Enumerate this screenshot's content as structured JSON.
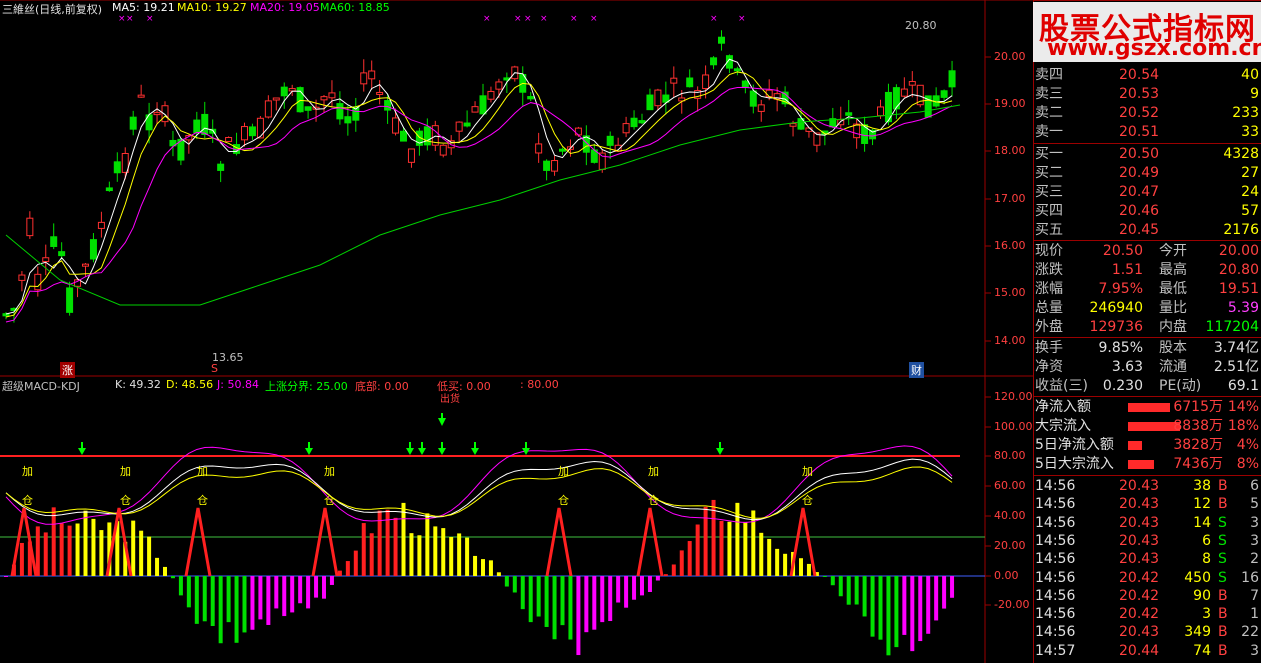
{
  "title": "三維丝(日线,前复权)",
  "ma": [
    {
      "label": "MA5: 19.21",
      "color": "#ffffff"
    },
    {
      "label": "MA10: 19.27",
      "color": "#ffff00"
    },
    {
      "label": "MA20: 19.05",
      "color": "#ff00ff"
    },
    {
      "label": "MA60: 18.85",
      "color": "#00ff00"
    }
  ],
  "price_axis": [
    "20.00",
    "19.00",
    "18.00",
    "17.00",
    "16.00",
    "15.00",
    "14.00"
  ],
  "annotations": {
    "high": "20.80",
    "low": "13.65",
    "zhang": "涨",
    "s": "S",
    "cai": "财"
  },
  "indicator": {
    "name": "超级MACD-KDJ",
    "k": "K: 49.32",
    "d": "D: 48.56",
    "j": "J: 50.84",
    "upper": "上涨分界: 25.00",
    "bottom": "底部: 0.00",
    "dimai": "低买: 0.00",
    "dimai2": ": 80.00",
    "chuhuo": "出货"
  },
  "ind_axis": [
    "120.00",
    "100.00",
    "80.00",
    "60.00",
    "40.00",
    "20.00",
    "0.00",
    "-20.00"
  ],
  "ind_signals": {
    "jia": "加",
    "cang": "仓"
  },
  "watermark": {
    "line1": "股票公式指标网",
    "line2": "www.gszx.com.cn"
  },
  "asks": [
    {
      "label": "卖四",
      "price": "20.54",
      "vol": "40"
    },
    {
      "label": "卖三",
      "price": "20.53",
      "vol": "9"
    },
    {
      "label": "卖二",
      "price": "20.52",
      "vol": "233"
    },
    {
      "label": "卖一",
      "price": "20.51",
      "vol": "33"
    }
  ],
  "bids": [
    {
      "label": "买一",
      "price": "20.50",
      "vol": "4328"
    },
    {
      "label": "买二",
      "price": "20.49",
      "vol": "27"
    },
    {
      "label": "买三",
      "price": "20.47",
      "vol": "24"
    },
    {
      "label": "买四",
      "price": "20.46",
      "vol": "57"
    },
    {
      "label": "买五",
      "price": "20.45",
      "vol": "2176"
    }
  ],
  "quote": [
    {
      "l1": "现价",
      "v1": "20.50",
      "c1": "#ff4040",
      "l2": "今开",
      "v2": "20.00",
      "c2": "#ff4040"
    },
    {
      "l1": "涨跌",
      "v1": "1.51",
      "c1": "#ff4040",
      "l2": "最高",
      "v2": "20.80",
      "c2": "#ff4040"
    },
    {
      "l1": "涨幅",
      "v1": "7.95%",
      "c1": "#ff4040",
      "l2": "最低",
      "v2": "19.51",
      "c2": "#ff4040"
    },
    {
      "l1": "总量",
      "v1": "246940",
      "c1": "#ffff00",
      "l2": "量比",
      "v2": "5.39",
      "c2": "#ff40ff"
    },
    {
      "l1": "外盘",
      "v1": "129736",
      "c1": "#ff4040",
      "l2": "内盘",
      "v2": "117204",
      "c2": "#00ff00"
    }
  ],
  "fund": [
    {
      "l1": "换手",
      "v1": "9.85%",
      "l2": "股本",
      "v2": "3.74亿"
    },
    {
      "l1": "净资",
      "v1": "3.63",
      "l2": "流通",
      "v2": "2.51亿"
    },
    {
      "l1": "收益(三)",
      "v1": "0.230",
      "l2": "PE(动)",
      "v2": "69.1"
    }
  ],
  "flows": [
    {
      "label": "净流入额",
      "val": "6715万",
      "pct": "14%",
      "w": 42
    },
    {
      "label": "大宗流入",
      "val": "8838万",
      "pct": "18%",
      "w": 52
    },
    {
      "label": "5日净流入额",
      "val": "3828万",
      "pct": "4%",
      "w": 14
    },
    {
      "label": "5日大宗流入",
      "val": "7436万",
      "pct": "8%",
      "w": 26
    }
  ],
  "ticks": [
    {
      "t": "14:56",
      "p": "20.43",
      "v": "38",
      "s": "B",
      "n": "6"
    },
    {
      "t": "14:56",
      "p": "20.43",
      "v": "12",
      "s": "B",
      "n": "5"
    },
    {
      "t": "14:56",
      "p": "20.43",
      "v": "14",
      "s": "S",
      "n": "3"
    },
    {
      "t": "14:56",
      "p": "20.43",
      "v": "6",
      "s": "S",
      "n": "3"
    },
    {
      "t": "14:56",
      "p": "20.43",
      "v": "8",
      "s": "S",
      "n": "2"
    },
    {
      "t": "14:56",
      "p": "20.42",
      "v": "450",
      "s": "S",
      "n": "16"
    },
    {
      "t": "14:56",
      "p": "20.42",
      "v": "90",
      "s": "B",
      "n": "7"
    },
    {
      "t": "14:56",
      "p": "20.42",
      "v": "3",
      "s": "B",
      "n": "1"
    },
    {
      "t": "14:56",
      "p": "20.43",
      "v": "349",
      "s": "B",
      "n": "22"
    },
    {
      "t": "14:57",
      "p": "20.44",
      "v": "74",
      "s": "B",
      "n": "3"
    }
  ]
}
